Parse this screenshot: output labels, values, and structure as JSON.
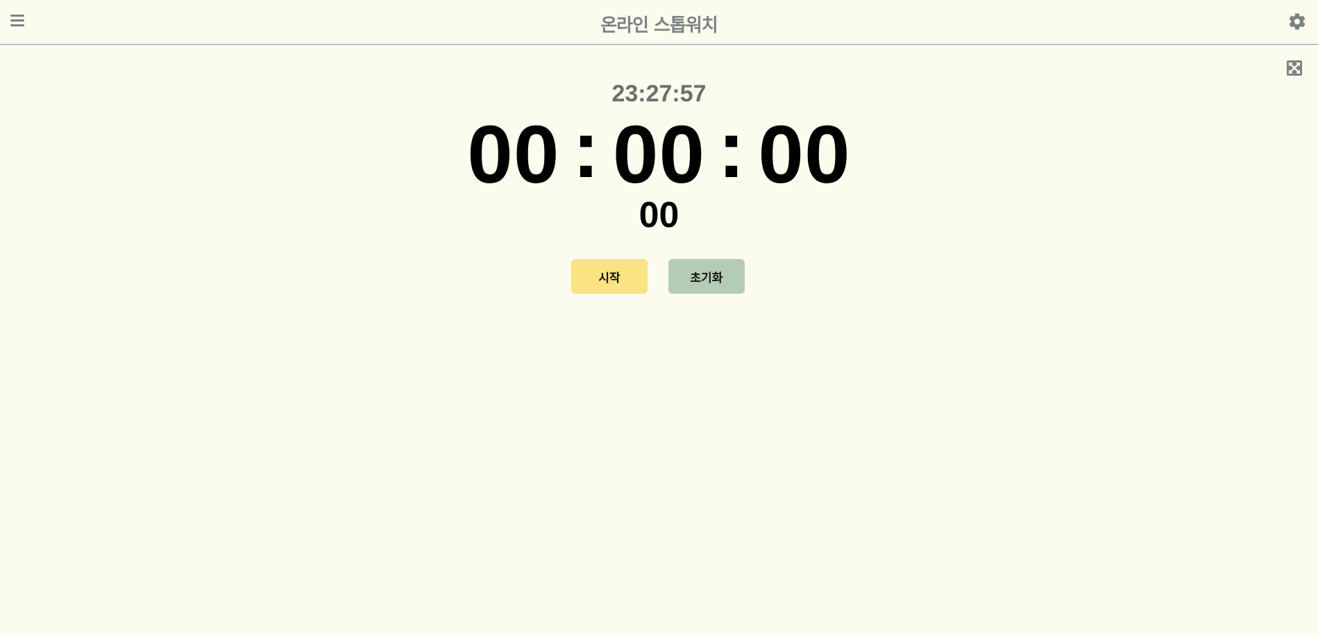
{
  "header": {
    "title": "온라인 스톱워치",
    "menu_icon": "hamburger-menu-icon",
    "settings_icon": "gear-icon"
  },
  "toolbar": {
    "fullscreen_icon": "expand-icon"
  },
  "clock": {
    "current_time": "23:27:57"
  },
  "stopwatch": {
    "hours": "00",
    "minutes": "00",
    "seconds": "00",
    "separator": ":",
    "centiseconds": "00"
  },
  "buttons": {
    "start_label": "시작",
    "reset_label": "초기화"
  },
  "colors": {
    "background": "#fbfbee",
    "title": "#7a8282",
    "start_button": "#fbe282",
    "reset_button": "#b5ccb4",
    "header_border": "#b5c8c8"
  }
}
